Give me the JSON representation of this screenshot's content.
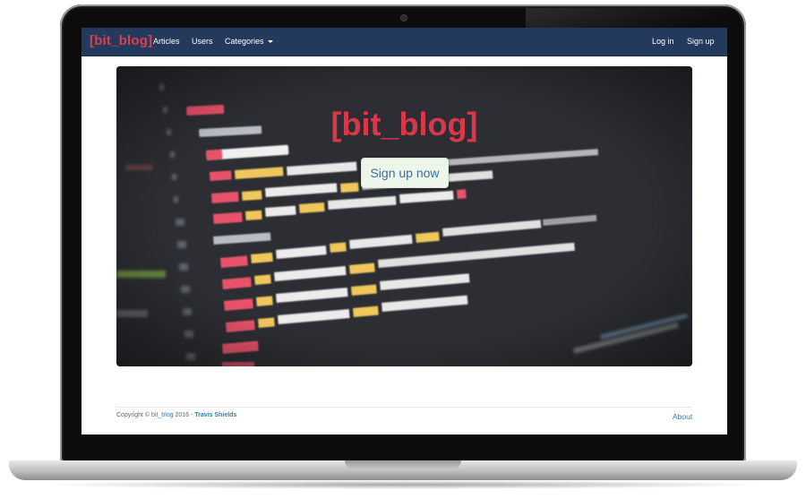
{
  "navbar": {
    "brand": "[bit_blog]",
    "links": {
      "articles": "Articles",
      "users": "Users",
      "categories": "Categories"
    },
    "right": {
      "login": "Log in",
      "signup": "Sign up"
    }
  },
  "hero": {
    "title": "[bit_blog]",
    "cta": "Sign up now",
    "background_icon": "code-editor-photo"
  },
  "footer": {
    "prefix": "Copyright © ",
    "brand_link": "bit_blog",
    "year_text": " 2016 - ",
    "author": "Travis Shields",
    "about": "About"
  },
  "colors": {
    "navbar_bg": "#233a5c",
    "brand_red": "#e23d4a",
    "link_blue": "#337ab7",
    "hero_bg": "#2b2d31",
    "cta_bg": "#eef6ea"
  }
}
